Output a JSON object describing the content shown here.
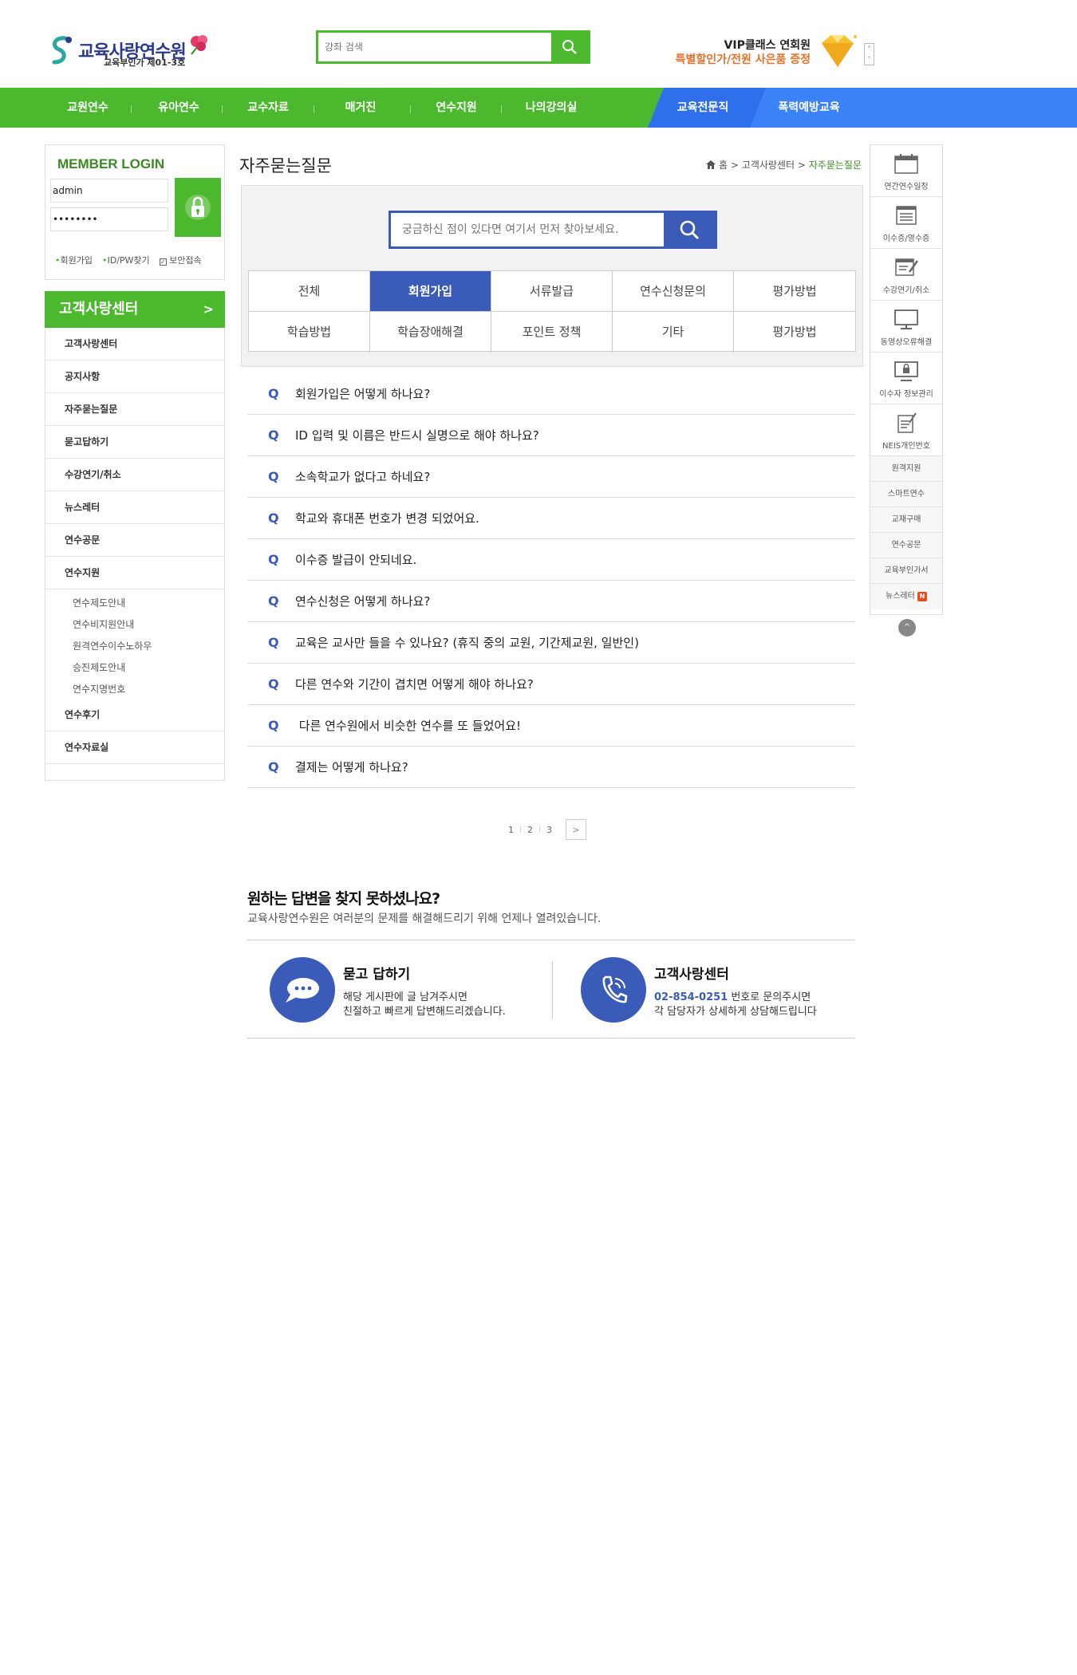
{
  "header": {
    "logo_title": "교육사랑연수원",
    "logo_sub": "교육부인가 제01-3호",
    "search_placeholder": "강좌 검색",
    "vip_line1": "VIP클래스 연회원",
    "vip_line2": "특별할인가/전원 사은품 증정"
  },
  "nav": {
    "items": [
      "교원연수",
      "유아연수",
      "교수자료",
      "매거진",
      "연수지원",
      "나의강의실"
    ],
    "blue_items": [
      "교육전문직",
      "폭력예방교육"
    ]
  },
  "login": {
    "title": "MEMBER LOGIN",
    "id_value": "admin",
    "pw_value": "••••••••",
    "links": [
      "회원가입",
      "ID/PW찾기",
      "보안접속"
    ]
  },
  "sidebar": {
    "head": "고객사랑센터",
    "head_arrow": ">",
    "items": [
      "고객사랑센터",
      "공지사항",
      "자주묻는질문",
      "묻고답하기",
      "수강연기/취소",
      "뉴스레터",
      "연수공문",
      "연수지원"
    ],
    "sub_items": [
      "연수제도안내",
      "연수비지원안내",
      "원격연수이수노하우",
      "승진제도안내",
      "연수지명번호"
    ],
    "items_after": [
      "연수후기",
      "연수자료실"
    ]
  },
  "main": {
    "page_title": "자주묻는질문",
    "breadcrumb": {
      "home": "홈",
      "sep": ">",
      "level1": "고객사랑센터",
      "current": "자주묻는질문"
    },
    "faq_search_placeholder": "궁금하신 점이 있다면 여기서 먼저 찾아보세요.",
    "categories": [
      "전체",
      "회원가입",
      "서류발급",
      "연수신청문의",
      "평가방법",
      "학습방법",
      "학습장애해결",
      "포인트 정책",
      "기타",
      "평가방법"
    ],
    "active_category": "회원가입",
    "q_mark": "Q",
    "questions": [
      "회원가입은 어떻게 하나요?",
      "ID 입력 및 이름은 반드시 실명으로 해야 하나요?",
      "소속학교가 없다고 하네요?",
      "학교와 휴대폰 번호가 변경 되었어요.",
      "이수증 발급이 안되네요.",
      "연수신청은 어떻게 하나요?",
      "교육은 교사만 들을 수 있나요? (휴직 중의 교원, 기간제교원, 일반인)",
      "다른 연수와 기간이 겹치면 어떻게 해야 하나요?",
      " 다른 연수원에서 비슷한 연수를 또 들었어요!",
      "결제는 어떻게 하나요?"
    ],
    "pager": [
      "1",
      "2",
      "3"
    ],
    "pager_next": ">"
  },
  "help": {
    "title": "원하는 답변을 찾지 못하셨나요?",
    "subtitle": "교육사랑연수원은 여러분의 문제를 해결해드리기 위해 언제나 열려있습니다.",
    "qna_title": "묻고 답하기",
    "qna_line1": "해당 게시판에 글 남겨주시면",
    "qna_line2": "친절하고 빠르게 답변해드리겠습니다.",
    "cs_title": "고객사랑센터",
    "cs_phone": "02-854-0251",
    "cs_line1_rest": " 번호로 문의주시면",
    "cs_line2": "각 담당자가 상세하게 상담해드립니다"
  },
  "quick": {
    "items": [
      "연간연수일정",
      "이수증/영수증",
      "수강연기/취소",
      "동영상오류해결",
      "이수자 정보관리",
      "NEIS개인번호"
    ],
    "small_items": [
      "원격지원",
      "스마트연수",
      "교재구매",
      "연수공문",
      "교육부인가서",
      "뉴스레터"
    ],
    "badge": "N",
    "top": "^"
  }
}
